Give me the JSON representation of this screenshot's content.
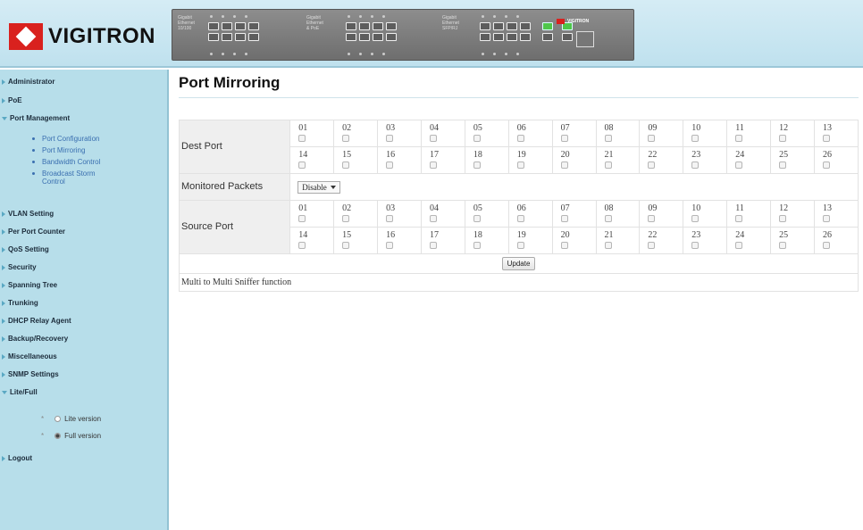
{
  "brand": {
    "name": "VIGITRON"
  },
  "device": {
    "group1_label": "Gigabit\nEthernet\n10/100",
    "group2_label": "Gigabit\nEthernet\n& PoE",
    "group3_label": "Gigabit\nEthernet\nSFP/RJ",
    "mini_brand": "VIGITRON"
  },
  "sidebar": {
    "items": [
      {
        "label": "Administrator"
      },
      {
        "label": "PoE"
      },
      {
        "label": "Port Management"
      },
      {
        "label": "VLAN Setting"
      },
      {
        "label": "Per Port Counter"
      },
      {
        "label": "QoS Setting"
      },
      {
        "label": "Security"
      },
      {
        "label": "Spanning Tree"
      },
      {
        "label": "Trunking"
      },
      {
        "label": "DHCP Relay Agent"
      },
      {
        "label": "Backup/Recovery"
      },
      {
        "label": "Miscellaneous"
      },
      {
        "label": "SNMP Settings"
      },
      {
        "label": "Lite/Full"
      },
      {
        "label": "Logout"
      }
    ],
    "port_mgmt_sub": [
      {
        "label": "Port Configuration"
      },
      {
        "label": "Port Mirroring"
      },
      {
        "label": "Bandwidth Control"
      },
      {
        "label": "Broadcast Storm Control"
      }
    ],
    "version_options": [
      {
        "label": "Lite version",
        "selected": false
      },
      {
        "label": "Full version",
        "selected": true
      }
    ]
  },
  "main": {
    "title": "Port Mirroring",
    "dest_label": "Dest Port",
    "monitored_label": "Monitored Packets",
    "monitored_value": "Disable",
    "source_label": "Source Port",
    "ports_row1": [
      "01",
      "02",
      "03",
      "04",
      "05",
      "06",
      "07",
      "08",
      "09",
      "10",
      "11",
      "12",
      "13"
    ],
    "ports_row2": [
      "14",
      "15",
      "16",
      "17",
      "18",
      "19",
      "20",
      "21",
      "22",
      "23",
      "24",
      "25",
      "26"
    ],
    "update_label": "Update",
    "note": "Multi to Multi Sniffer function"
  }
}
